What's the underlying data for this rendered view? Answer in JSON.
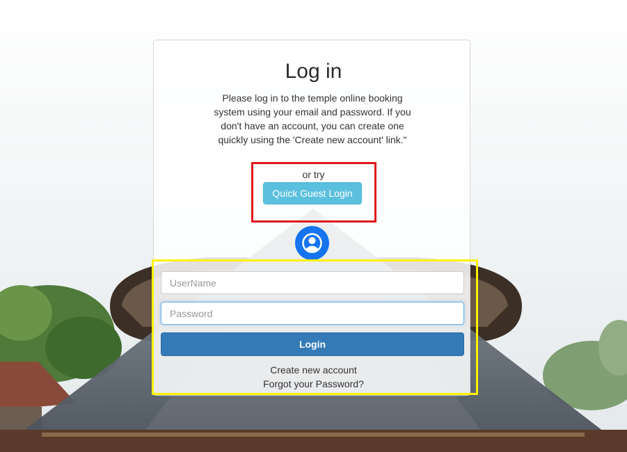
{
  "page": {
    "title": "Log in",
    "intro": "Please log in to the temple online booking system using your email and password. If you don't have an account, you can create one quickly using the 'Create new account' link.\"",
    "or_try": "or try",
    "guest_button": "Quick Guest Login"
  },
  "form": {
    "username_placeholder": "UserName",
    "password_placeholder": "Password",
    "login_button": "Login",
    "create_account": "Create new account",
    "forgot_password": "Forgot your Password?"
  },
  "icons": {
    "avatar": "user-avatar-icon"
  },
  "colors": {
    "guest_button": "#5bc0de",
    "login_button": "#337ab7",
    "avatar": "#1674ee",
    "highlight_red": "#e0171d",
    "highlight_yellow": "#fff200"
  }
}
